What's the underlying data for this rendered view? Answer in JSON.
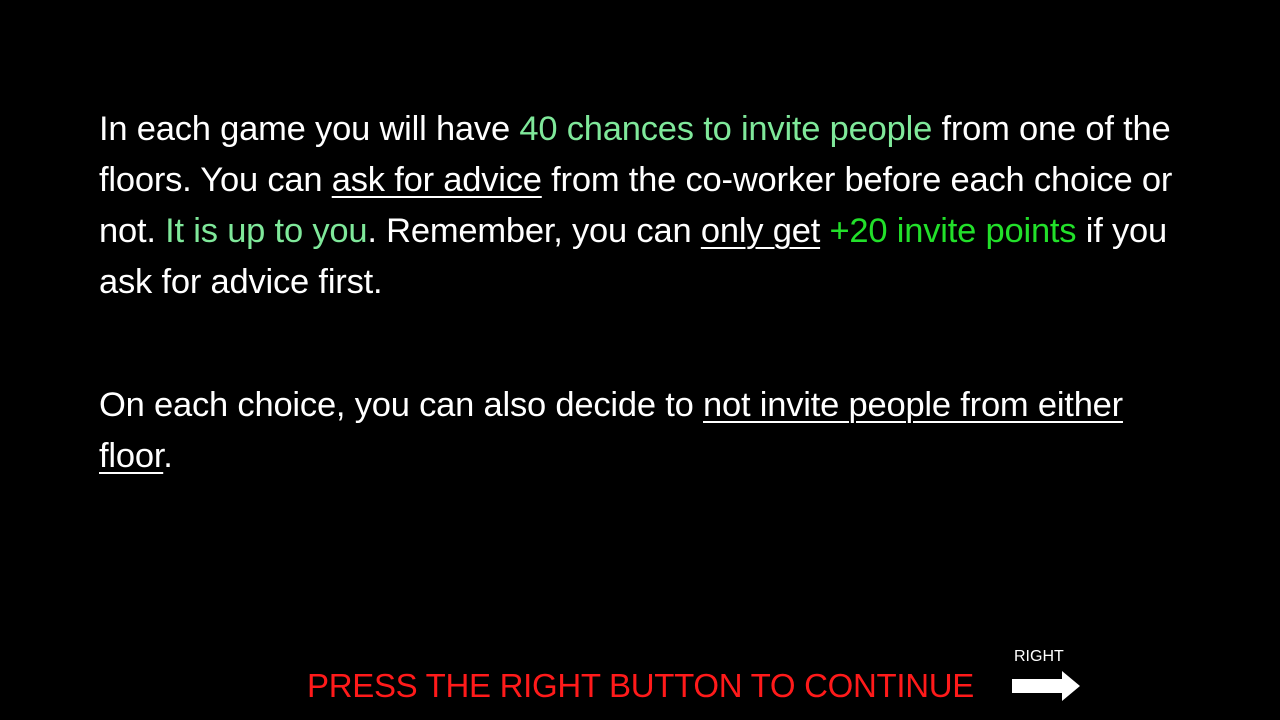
{
  "paragraph1": {
    "p1": "In each game you will have ",
    "p2": "40 chances to invite people",
    "p3": " from one of the floors. You can ",
    "p4": "ask for advice",
    "p5": " from the co-worker before each choice or not. ",
    "p6": "It is up to you",
    "p7": ". Remember, you can ",
    "p8": "only get",
    "p9": " ",
    "p10": "+20 invite points",
    "p11": " if you ask for advice first."
  },
  "paragraph2": {
    "p1": "On each choice, you can also decide to ",
    "p2": "not invite people from either floor",
    "p3": "."
  },
  "footer": {
    "continue_text": "PRESS THE RIGHT BUTTON TO CONTINUE",
    "right_label": "RIGHT"
  },
  "icons": {
    "arrow": "right-arrow-icon"
  },
  "colors": {
    "background": "#000000",
    "text": "#ffffff",
    "highlight_light_green": "#7fe89a",
    "highlight_bright_green": "#22e02a",
    "continue_red": "#ff1a1a"
  }
}
